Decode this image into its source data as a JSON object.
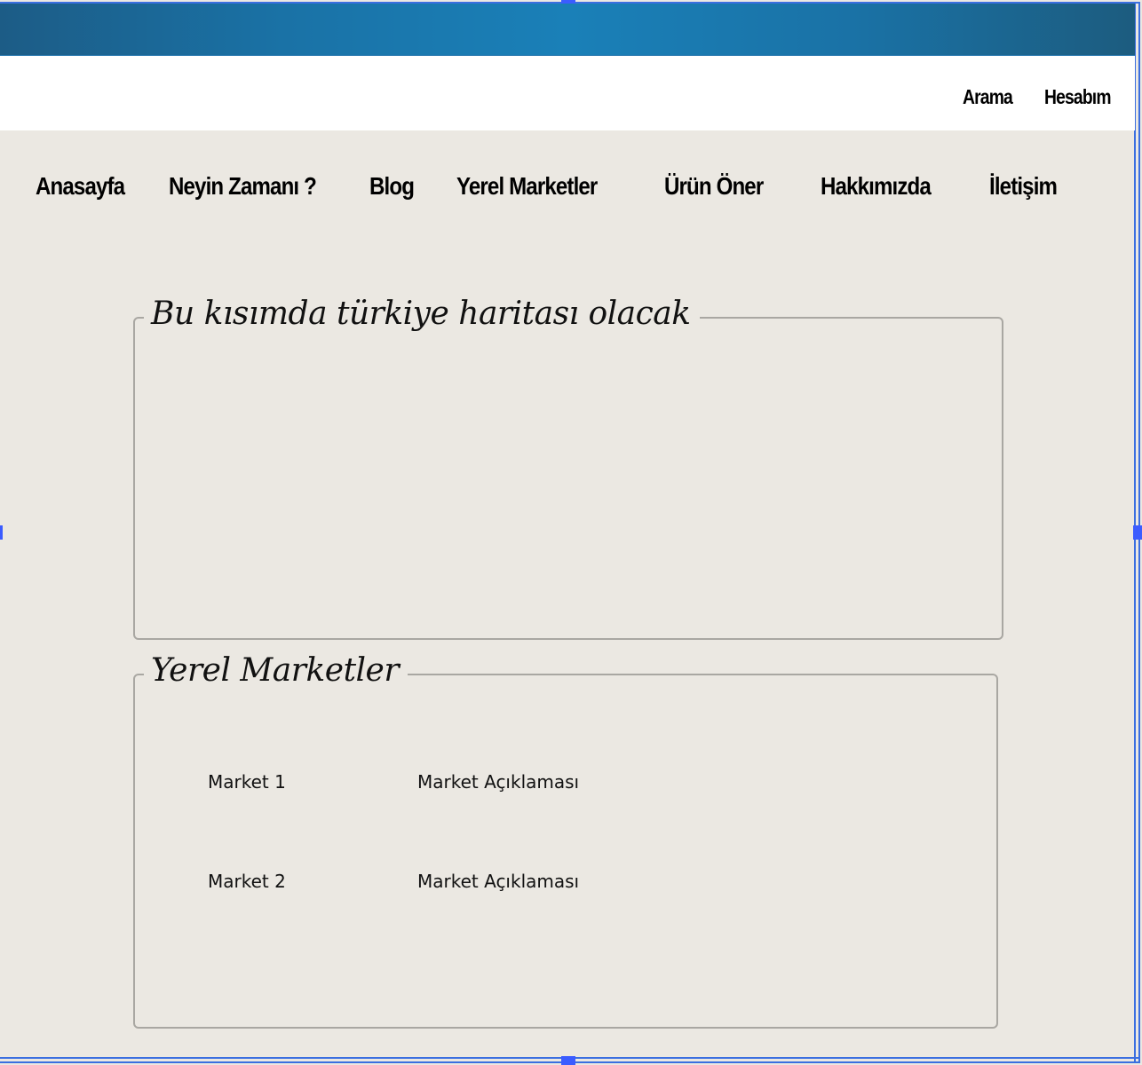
{
  "colors": {
    "topbar_gradient_start": "#1c5c86",
    "topbar_gradient_mid": "#1a80b8",
    "page_background": "#ebe8e2",
    "header_background": "#ffffff",
    "selection_frame": "#3b6fe0"
  },
  "utility_links": [
    "Arama",
    "Hesabım"
  ],
  "nav": {
    "items": [
      "Anasayfa",
      "Neyin Zamanı ?",
      "Blog",
      "Yerel Marketler",
      "Ürün Öner",
      "Hakkımızda",
      "İletişim"
    ]
  },
  "map_section": {
    "legend": "Bu kısımda türkiye haritası olacak"
  },
  "markets_section": {
    "legend": "Yerel Marketler",
    "markets": [
      {
        "name": "Market 1",
        "description": "Market Açıklaması"
      },
      {
        "name": "Market 2",
        "description": "Market Açıklaması"
      }
    ]
  }
}
